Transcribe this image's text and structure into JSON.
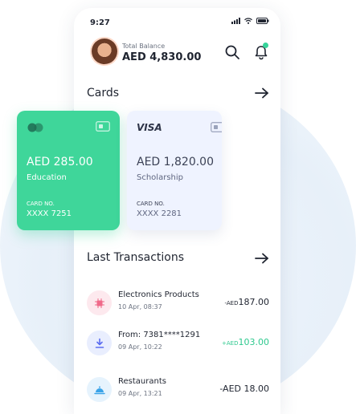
{
  "status_bar": {
    "time": "9:27"
  },
  "header": {
    "balance_label": "Total Balance",
    "balance_value": "AED 4,830.00"
  },
  "cards_section": {
    "title": "Cards"
  },
  "cards": [
    {
      "brand": "mastercard",
      "amount": "AED 285.00",
      "category": "Education",
      "card_no_label": "CARD NO.",
      "card_no": "XXXX 7251",
      "color": "#3fd69a"
    },
    {
      "brand": "VISA",
      "amount": "AED 1,820.00",
      "category": "Scholarship",
      "card_no_label": "CARD NO.",
      "card_no": "XXXX 2281",
      "color": "#eff3ff"
    }
  ],
  "transactions_section": {
    "title": "Last Transactions"
  },
  "transactions": [
    {
      "name": "Electronics Products",
      "date": "10 Apr, 08:37",
      "prefix": "-AED",
      "amount": "187.00",
      "icon": "chip-icon",
      "icon_bg": "#fde9ee",
      "icon_color": "#f06a8a"
    },
    {
      "name": "From: 7381****1291",
      "date": "09 Apr, 10:22",
      "prefix": "+AED",
      "amount": "103.00",
      "icon": "download-icon",
      "icon_bg": "#e9eefe",
      "icon_color": "#5b6df0"
    },
    {
      "name": "Restaurants",
      "date": "09 Apr, 13:21",
      "prefix": "-AED ",
      "amount": "18.00",
      "icon": "food-cover-icon",
      "icon_bg": "#e6f3fd",
      "icon_color": "#3aa3e8"
    }
  ]
}
